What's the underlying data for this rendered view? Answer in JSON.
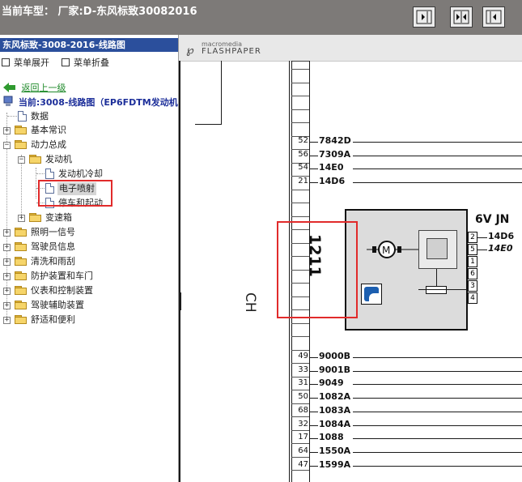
{
  "header": {
    "title": "当前车型： 厂家:D-东风标致30082016",
    "buttons": [
      "align-right-icon",
      "split-icon",
      "align-left-icon"
    ]
  },
  "tree": {
    "panel_title": "东风标致-3008-2016-线路图",
    "expand_label": "菜单展开",
    "collapse_label": "菜单折叠",
    "back_label": "返回上一级",
    "current_label": "当前:3008-线路图（EP6FDTM发动机",
    "items": [
      {
        "label": "数据"
      },
      {
        "label": "基本常识"
      },
      {
        "label": "动力总成"
      },
      {
        "label": "发动机"
      },
      {
        "label": "发动机冷却"
      },
      {
        "label": "电子喷射"
      },
      {
        "label": "停车和起动"
      },
      {
        "label": "变速箱"
      },
      {
        "label": "照明一信号"
      },
      {
        "label": "驾驶员信息"
      },
      {
        "label": "清洗和雨刮"
      },
      {
        "label": "防护装置和车门"
      },
      {
        "label": "仪表和控制装置"
      },
      {
        "label": "驾驶辅助装置"
      },
      {
        "label": "舒适和便利"
      }
    ]
  },
  "viewer": {
    "brand_line1": "macromedia",
    "brand_line2": "FLASHPAPER",
    "connector_label": "CH",
    "component_number": "1211",
    "connector_name": "6V JN",
    "component_wires": [
      {
        "pin": "2",
        "signal": "14D6"
      },
      {
        "pin": "5",
        "signal": "14E0"
      },
      {
        "pin": "1",
        "signal": ""
      },
      {
        "pin": "6",
        "signal": ""
      },
      {
        "pin": "3",
        "signal": ""
      },
      {
        "pin": "4",
        "signal": ""
      }
    ],
    "upper_wires": [
      {
        "pin": "52",
        "signal": "7842D"
      },
      {
        "pin": "56",
        "signal": "7309A"
      },
      {
        "pin": "54",
        "signal": "14E0"
      },
      {
        "pin": "21",
        "signal": "14D6"
      }
    ],
    "lower_wires": [
      {
        "pin": "49",
        "signal": "9000B"
      },
      {
        "pin": "33",
        "signal": "9001B"
      },
      {
        "pin": "31",
        "signal": "9049"
      },
      {
        "pin": "50",
        "signal": "1082A"
      },
      {
        "pin": "68",
        "signal": "1083A"
      },
      {
        "pin": "32",
        "signal": "1084A"
      },
      {
        "pin": "17",
        "signal": "1088"
      },
      {
        "pin": "64",
        "signal": "1550A"
      },
      {
        "pin": "47",
        "signal": "1599A"
      }
    ]
  }
}
